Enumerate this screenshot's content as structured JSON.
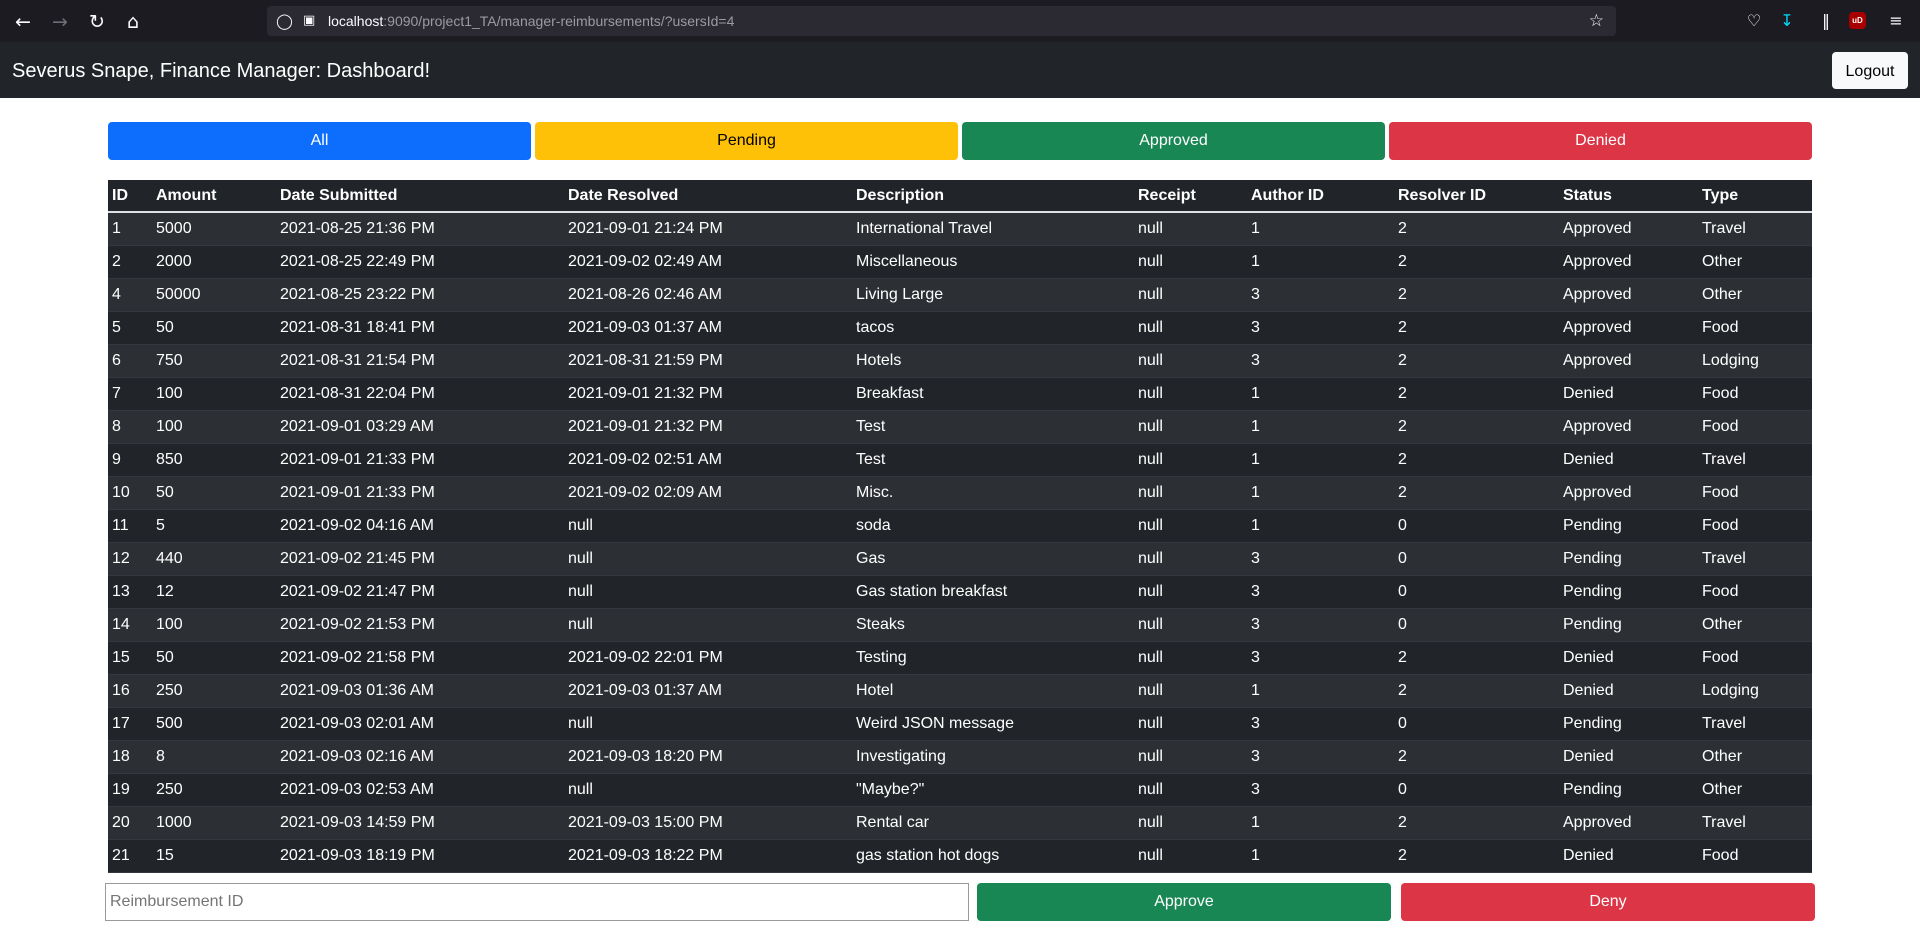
{
  "browser": {
    "url_host": "localhost",
    "url_rest": ":9090/project1_TA/manager-reimbursements/?usersId=4",
    "ublock_label": "uD",
    "icons": {
      "back": "back-arrow-icon",
      "forward": "forward-arrow-icon",
      "reload": "reload-icon",
      "home": "home-icon",
      "shield": "shield-icon",
      "page": "page-icon",
      "bookmark": "star-icon",
      "pocket": "pocket-icon",
      "downloads": "download-icon",
      "library": "library-icon",
      "ublock": "ublock-icon",
      "menu": "hamburger-menu-icon"
    }
  },
  "header": {
    "title": "Severus Snape, Finance Manager: Dashboard!",
    "logout_label": "Logout"
  },
  "filters": {
    "all": "All",
    "pending": "Pending",
    "approved": "Approved",
    "denied": "Denied"
  },
  "table": {
    "columns": [
      "ID",
      "Amount",
      "Date Submitted",
      "Date Resolved",
      "Description",
      "Receipt",
      "Author ID",
      "Resolver ID",
      "Status",
      "Type"
    ],
    "rows": [
      [
        "1",
        "5000",
        "2021-08-25 21:36 PM",
        "2021-09-01 21:24 PM",
        "International Travel",
        "null",
        "1",
        "2",
        "Approved",
        "Travel"
      ],
      [
        "2",
        "2000",
        "2021-08-25 22:49 PM",
        "2021-09-02 02:49 AM",
        "Miscellaneous",
        "null",
        "1",
        "2",
        "Approved",
        "Other"
      ],
      [
        "4",
        "50000",
        "2021-08-25 23:22 PM",
        "2021-08-26 02:46 AM",
        "Living Large",
        "null",
        "3",
        "2",
        "Approved",
        "Other"
      ],
      [
        "5",
        "50",
        "2021-08-31 18:41 PM",
        "2021-09-03 01:37 AM",
        "tacos",
        "null",
        "3",
        "2",
        "Approved",
        "Food"
      ],
      [
        "6",
        "750",
        "2021-08-31 21:54 PM",
        "2021-08-31 21:59 PM",
        "Hotels",
        "null",
        "3",
        "2",
        "Approved",
        "Lodging"
      ],
      [
        "7",
        "100",
        "2021-08-31 22:04 PM",
        "2021-09-01 21:32 PM",
        "Breakfast",
        "null",
        "1",
        "2",
        "Denied",
        "Food"
      ],
      [
        "8",
        "100",
        "2021-09-01 03:29 AM",
        "2021-09-01 21:32 PM",
        "Test",
        "null",
        "1",
        "2",
        "Approved",
        "Food"
      ],
      [
        "9",
        "850",
        "2021-09-01 21:33 PM",
        "2021-09-02 02:51 AM",
        "Test",
        "null",
        "1",
        "2",
        "Denied",
        "Travel"
      ],
      [
        "10",
        "50",
        "2021-09-01 21:33 PM",
        "2021-09-02 02:09 AM",
        "Misc.",
        "null",
        "1",
        "2",
        "Approved",
        "Food"
      ],
      [
        "11",
        "5",
        "2021-09-02 04:16 AM",
        "null",
        "soda",
        "null",
        "1",
        "0",
        "Pending",
        "Food"
      ],
      [
        "12",
        "440",
        "2021-09-02 21:45 PM",
        "null",
        "Gas",
        "null",
        "3",
        "0",
        "Pending",
        "Travel"
      ],
      [
        "13",
        "12",
        "2021-09-02 21:47 PM",
        "null",
        "Gas station breakfast",
        "null",
        "3",
        "0",
        "Pending",
        "Food"
      ],
      [
        "14",
        "100",
        "2021-09-02 21:53 PM",
        "null",
        "Steaks",
        "null",
        "3",
        "0",
        "Pending",
        "Other"
      ],
      [
        "15",
        "50",
        "2021-09-02 21:58 PM",
        "2021-09-02 22:01 PM",
        "Testing",
        "null",
        "3",
        "2",
        "Denied",
        "Food"
      ],
      [
        "16",
        "250",
        "2021-09-03 01:36 AM",
        "2021-09-03 01:37 AM",
        "Hotel",
        "null",
        "1",
        "2",
        "Denied",
        "Lodging"
      ],
      [
        "17",
        "500",
        "2021-09-03 02:01 AM",
        "null",
        "Weird JSON message",
        "null",
        "3",
        "0",
        "Pending",
        "Travel"
      ],
      [
        "18",
        "8",
        "2021-09-03 02:16 AM",
        "2021-09-03 18:20 PM",
        "Investigating",
        "null",
        "3",
        "2",
        "Denied",
        "Other"
      ],
      [
        "19",
        "250",
        "2021-09-03 02:53 AM",
        "null",
        "\"Maybe?\"",
        "null",
        "3",
        "0",
        "Pending",
        "Other"
      ],
      [
        "20",
        "1000",
        "2021-09-03 14:59 PM",
        "2021-09-03 15:00 PM",
        "Rental car",
        "null",
        "1",
        "2",
        "Approved",
        "Travel"
      ],
      [
        "21",
        "15",
        "2021-09-03 18:19 PM",
        "2021-09-03 18:22 PM",
        "gas station hot dogs",
        "null",
        "1",
        "2",
        "Denied",
        "Food"
      ]
    ]
  },
  "actions": {
    "reimbursement_placeholder": "Reimbursement ID",
    "reimbursement_value": "",
    "approve_label": "Approve",
    "deny_label": "Deny"
  },
  "colors": {
    "primary": "#0d6efd",
    "warning": "#ffc107",
    "success": "#198754",
    "danger": "#dc3545",
    "dark": "#212529"
  }
}
